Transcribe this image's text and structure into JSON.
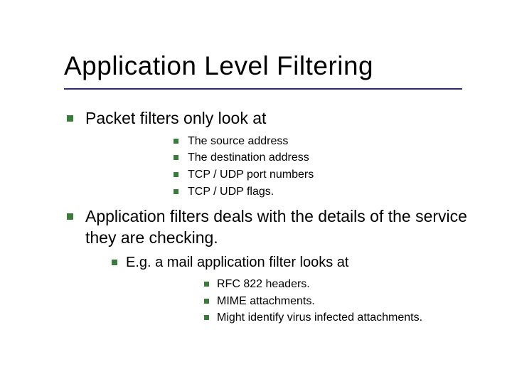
{
  "title": "Application Level Filtering",
  "bullets": [
    {
      "text": "Packet filters only look at",
      "children": [
        {
          "text": "The source address"
        },
        {
          "text": "The destination address"
        },
        {
          "text": "TCP / UDP port numbers"
        },
        {
          "text": "TCP / UDP flags."
        }
      ]
    },
    {
      "text": "Application filters deals with the details of the service they are checking.",
      "children_style": "b",
      "children": [
        {
          "text": "E.g. a mail application filter looks at",
          "children": [
            {
              "text": "RFC 822 headers."
            },
            {
              "text": "MIME attachments."
            },
            {
              "text": "Might identify virus infected attachments."
            }
          ]
        }
      ]
    }
  ]
}
